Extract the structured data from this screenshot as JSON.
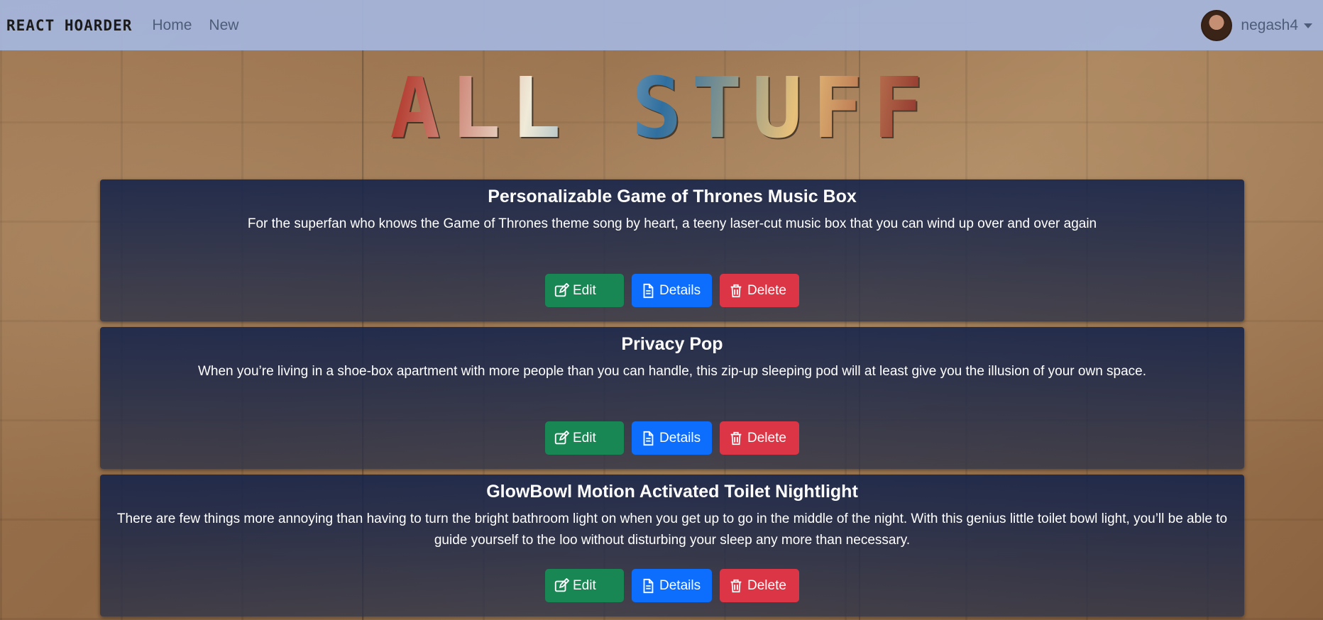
{
  "navbar": {
    "brand": "React Hoarder",
    "links": [
      "Home",
      "New"
    ],
    "username": "negash4"
  },
  "hero": {
    "title": "All Stuff"
  },
  "items": [
    {
      "title": "Personalizable Game of Thrones Music Box",
      "description": "For the superfan who knows the Game of Thrones theme song by heart, a teeny laser-cut music box that you can wind up over and over again",
      "edit_label": "Edit",
      "details_label": "Details",
      "delete_label": "Delete"
    },
    {
      "title": "Privacy Pop",
      "description": "When you’re living in a shoe-box apartment with more people than you can handle, this zip-up sleeping pod will at least give you the illusion of your own space.",
      "edit_label": "Edit",
      "details_label": "Details",
      "delete_label": "Delete"
    },
    {
      "title": "GlowBowl Motion Activated Toilet Nightlight",
      "description": "There are few things more annoying than having to turn the bright bathroom light on when you get up to go in the middle of the night. With this genius little toilet bowl light, you’ll be able to guide yourself to the loo without disturbing your sleep any more than necessary.",
      "edit_label": "Edit",
      "details_label": "Details",
      "delete_label": "Delete"
    }
  ],
  "colors": {
    "navbar": "#a5b6de",
    "edit": "#198754",
    "details": "#0d6efd",
    "delete": "#dc3545"
  },
  "icons": {
    "edit": "pencil-square-icon",
    "details": "document-icon",
    "delete": "trash-icon"
  }
}
